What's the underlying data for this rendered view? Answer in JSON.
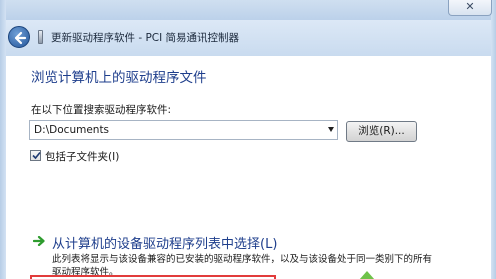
{
  "window": {
    "close_label": "✕",
    "title": "更新驱动程序软件 - PCI 简易通讯控制器"
  },
  "page": {
    "title": "浏览计算机上的驱动程序文件",
    "search_label": "在以下位置搜索驱动程序软件:",
    "path_value": "D:\\Documents",
    "browse_label": "浏览(R)...",
    "include_subfolders_label": "包括子文件夹(I)",
    "include_subfolders_checked": true
  },
  "pick_option": {
    "title": "从计算机的设备驱动程序列表中选择(L)",
    "desc_line1": "此列表将显示与该设备兼容的已安装的驱动程序软件，以及与该设备处于同一类别下的所有",
    "desc_line2": "驱动程序软件。"
  },
  "colors": {
    "accent": "#1e3e8c",
    "highlight": "#e23b3b",
    "arrow_green": "#2e9c2e"
  },
  "icons": {
    "back": "back-arrow-icon",
    "device": "device-icon",
    "checkbox": "checkmark-icon",
    "option": "green-arrow-icon"
  }
}
